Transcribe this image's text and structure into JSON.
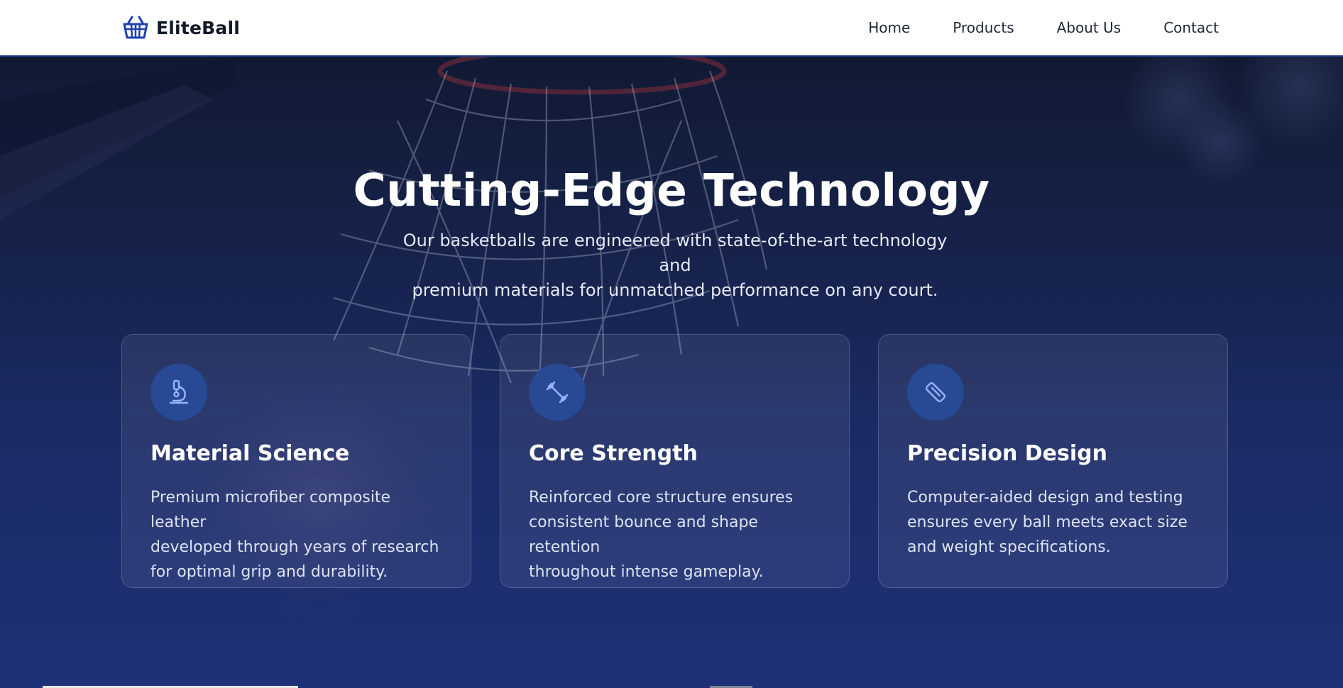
{
  "header": {
    "brand": "EliteBall",
    "brand_icon": "basket-icon",
    "nav": [
      "Home",
      "Products",
      "About Us",
      "Contact"
    ]
  },
  "hero": {
    "title": "Cutting-Edge Technology",
    "subtitle_line1": "Our basketballs are engineered with state-of-the-art technology and",
    "subtitle_line2": "premium materials for unmatched performance on any court."
  },
  "features": [
    {
      "icon": "microscope-icon",
      "title": "Material Science",
      "lines": [
        "Premium microfiber composite leather",
        "developed through years of research",
        "for optimal grip and durability."
      ]
    },
    {
      "icon": "dumbbell-icon",
      "title": "Core Strength",
      "lines": [
        "Reinforced core structure ensures",
        "consistent bounce and shape retention",
        "throughout intense gameplay."
      ]
    },
    {
      "icon": "ruler-icon",
      "title": "Precision Design",
      "lines": [
        "Computer-aided design and testing",
        "ensures every ball meets exact size",
        "and weight specifications."
      ]
    }
  ],
  "colors": {
    "accent": "#1e3a8a",
    "icon_bg": "#284a95",
    "icon_stroke": "#93b4f5"
  }
}
